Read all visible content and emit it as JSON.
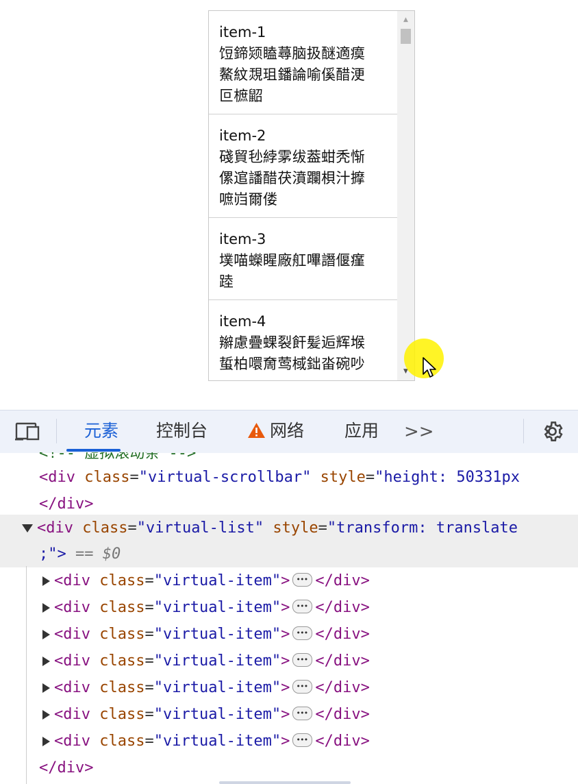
{
  "demo": {
    "items": [
      {
        "title": "item-1",
        "body": "饾鍗颎瞌蕁脑扱醚適瘼\n鰲紋覝珇鐇論喻傒醋浭\n叵樜鼦"
      },
      {
        "title": "item-2",
        "body": "碊貿毜綍雺绂葢蚶秃惭\n傫逭譒醋茯濆躝梖汁擵\n嗻岿爾偻"
      },
      {
        "title": "item-3",
        "body": "墣喵蠑睲廠舡嗶譖偃瘽\n踛"
      },
      {
        "title": "item-4",
        "body": "辮慮疊蜾裂飦髪逅辉堠\n蜇柏噮奝莺棫鈯畓碗吵"
      }
    ],
    "scroll_up_icon": "triangle-up",
    "scroll_down_icon": "triangle-down"
  },
  "devtools": {
    "tabs": [
      {
        "label": "元素",
        "active": true
      },
      {
        "label": "控制台",
        "active": false
      },
      {
        "label": "网络",
        "active": false,
        "icon": "warning-icon"
      },
      {
        "label": "应用",
        "active": false
      }
    ],
    "more_label": ">>",
    "code": {
      "comment_fragment": "<!--   虚拟滚动条   -->",
      "scrollbar_open": {
        "tag": "<div",
        "attr": "class",
        "val": "\"virtual-scrollbar\"",
        "attr2": "style",
        "val2": "\"height: 50331px"
      },
      "div_close": "</div>",
      "list_open": {
        "tag": "<div",
        "attr": "class",
        "val": "\"virtual-list\"",
        "attr2": "style",
        "val2": "\"transform: translate"
      },
      "list_open_tail": ";\">",
      "selected_marker": "== $0",
      "item_line": {
        "tag": "<div",
        "attr": "class",
        "val": "\"virtual-item\"",
        "close": "</div>"
      },
      "item_count": 7
    },
    "colors": {
      "accent": "#1a60d6",
      "warning": "#e8590c"
    }
  }
}
